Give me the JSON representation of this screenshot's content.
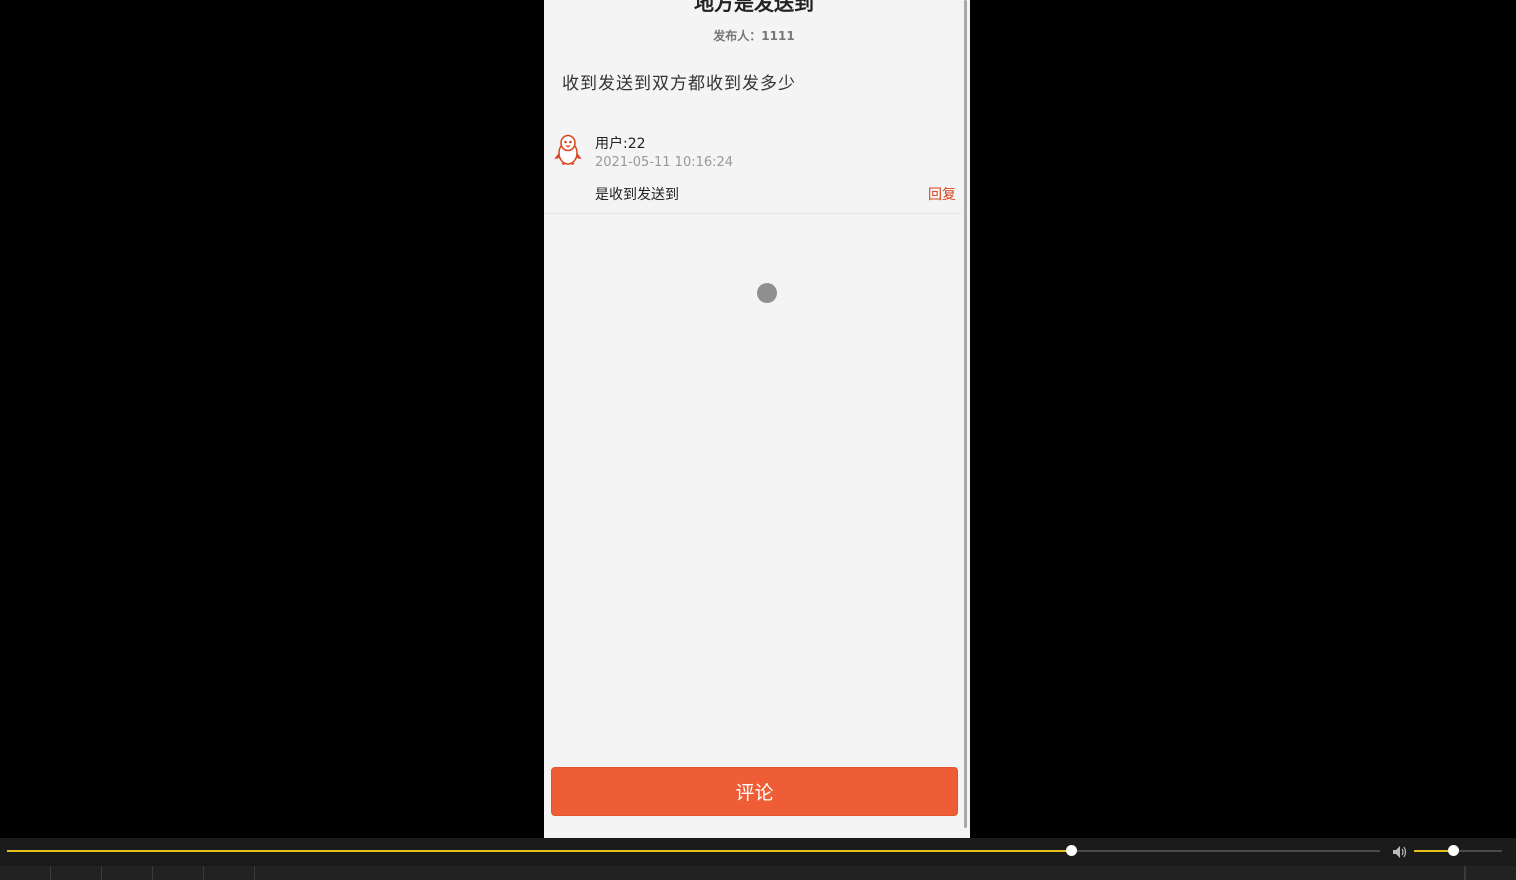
{
  "post": {
    "title": "地方是发送到",
    "publisher": "发布人：1111",
    "body": "收到发送到双方都收到发多少"
  },
  "comments": [
    {
      "user": "用户:22",
      "time": "2021-05-11 10:16:24",
      "text": "是收到发送到",
      "reply_label": "回复",
      "avatar_icon": "penguin-icon"
    }
  ],
  "comment_button": {
    "label": "评论"
  },
  "player": {
    "progress": 0.775,
    "volume": 0.44
  },
  "colors": {
    "accent": "#ee5d36",
    "reply": "#d9441f",
    "progress": "#e4c21a"
  }
}
